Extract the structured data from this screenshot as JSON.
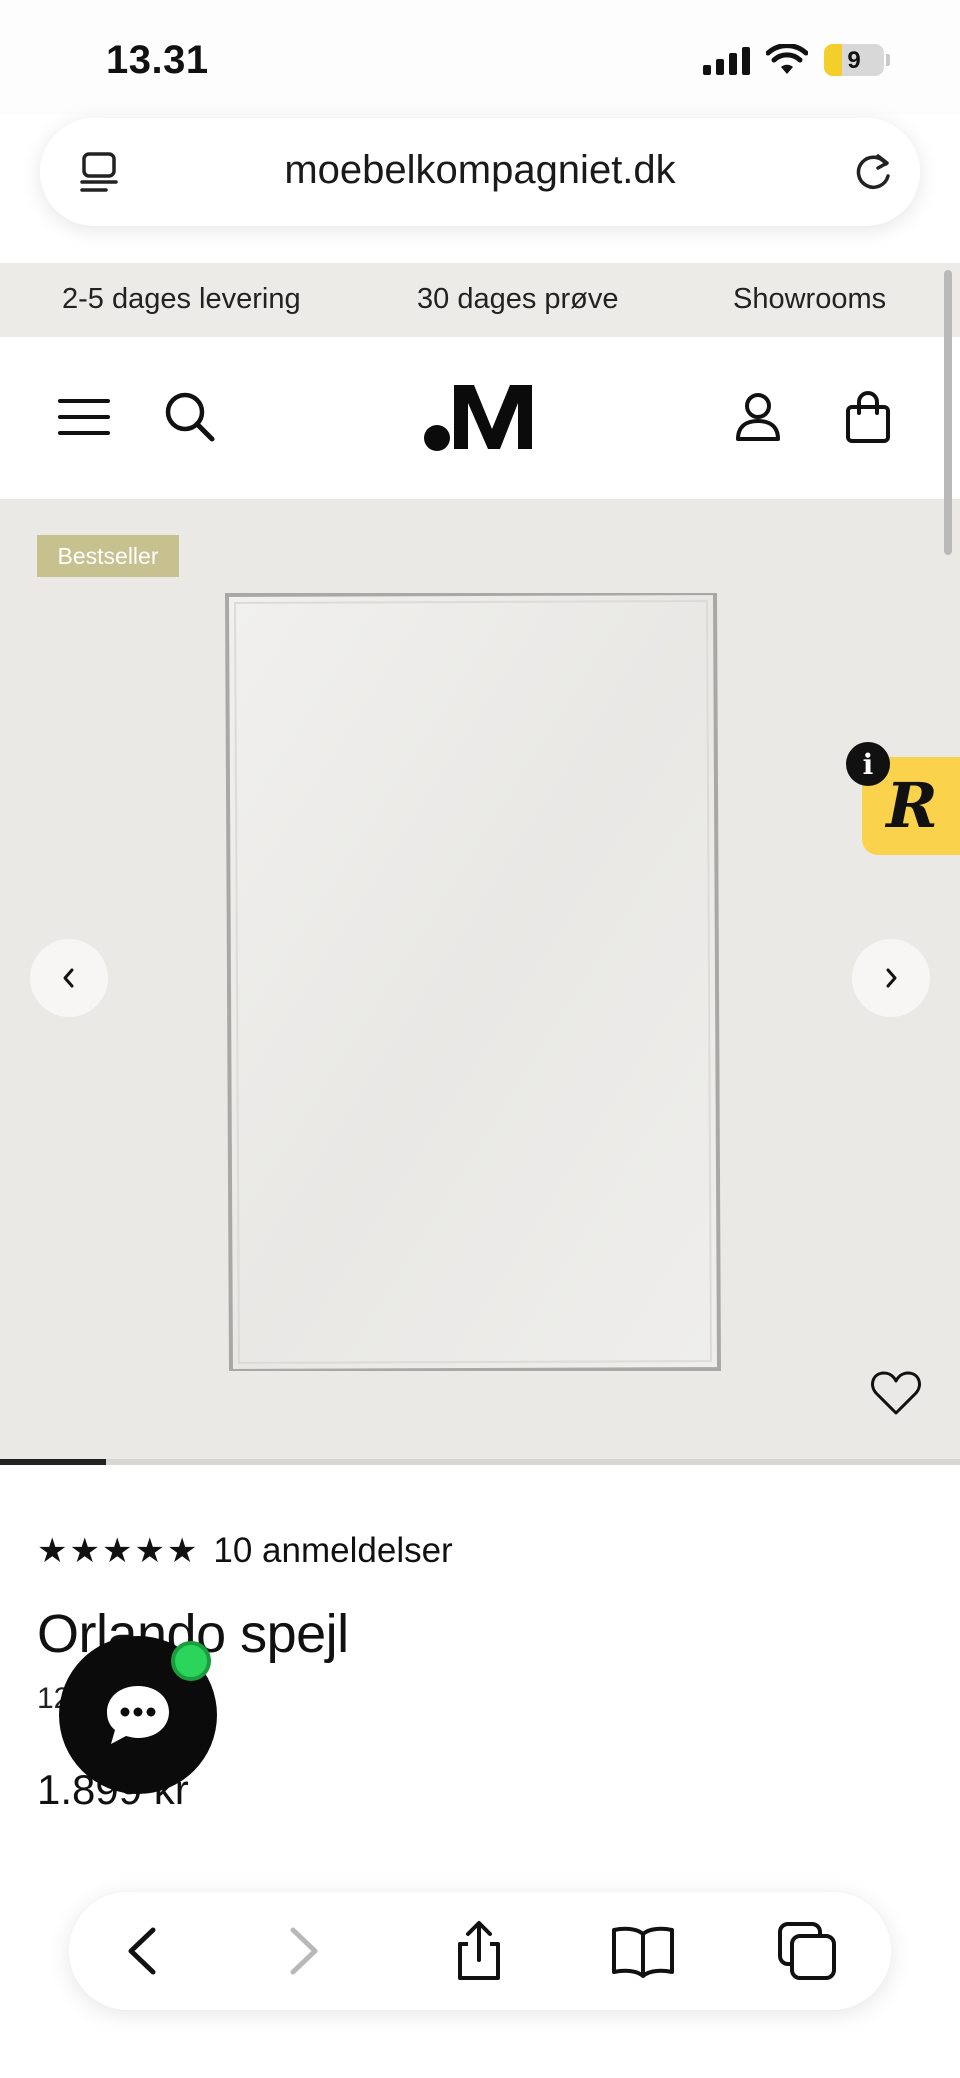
{
  "status_bar": {
    "time": "13.31",
    "battery": "9"
  },
  "browser": {
    "url": "moebelkompagniet.dk",
    "toolbar": [
      "back",
      "forward",
      "share",
      "bookmarks",
      "tabs"
    ]
  },
  "promo_bar": {
    "items": [
      "2-5 dages levering",
      "30 dages prøve",
      "Showrooms"
    ]
  },
  "site_header": {
    "logo": ".M",
    "icons": [
      "menu-icon",
      "search-icon",
      "account-icon",
      "cart-icon"
    ]
  },
  "gallery": {
    "badge": "Bestseller",
    "progress": 0.11,
    "review_widget_info": "i",
    "review_widget_letter": "R"
  },
  "product": {
    "stars": "★★★★★",
    "rating": 5,
    "review_count": "10 anmeldelser",
    "title": "Orlando spejl",
    "subtitle": "12",
    "price": "1.899 kr"
  },
  "colors": {
    "badge": "#c7c190",
    "review_widget": "#fbd24b",
    "chat_online": "#2bd45a",
    "hero_bg": "#ebe9e6",
    "promo_bg": "#ecebe8"
  }
}
